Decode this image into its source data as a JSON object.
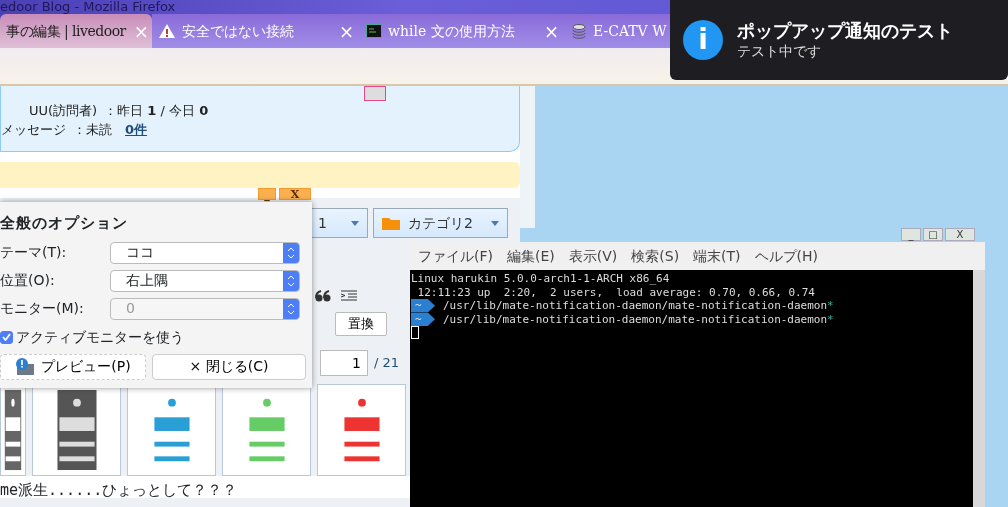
{
  "browser": {
    "title": "edoor Blog - Mozilla Firefox",
    "tabs": [
      {
        "label": "事の編集 | livedoor",
        "selected": true,
        "kind": "plain",
        "close": "×"
      },
      {
        "label": "安全ではない接続",
        "selected": false,
        "kind": "warning",
        "close": "×"
      },
      {
        "label": "while 文の使用方法",
        "selected": false,
        "kind": "terminal",
        "close": "×"
      },
      {
        "label": "E-CATV W",
        "selected": false,
        "kind": "stack"
      }
    ],
    "stats": [
      {
        "link": "UU(訪問者)",
        "text": "：昨日 **1** / 今日 **0**"
      },
      {
        "link": "メッセージ",
        "text": "：未読",
        "count": "0件"
      }
    ],
    "categories": [
      {
        "label": "1",
        "kind": "plain"
      },
      {
        "label": "カテゴリ2",
        "kind": "folder"
      }
    ],
    "replace_button": "置換",
    "page_input": "1",
    "page_total": "/ 21",
    "caption": "me派生......ひょっとして？？？"
  },
  "dialog": {
    "window_buttons": [
      "_",
      "X"
    ],
    "title": "全般のオプション",
    "fields": [
      {
        "label": "テーマ(T):",
        "value": "ココ",
        "disabled": false
      },
      {
        "label": "位置(O):",
        "value": "右上隅",
        "disabled": false
      },
      {
        "label": "モニター(M):",
        "value": "0",
        "disabled": true
      }
    ],
    "checkbox": {
      "label": "アクティブモニターを使う",
      "checked": true
    },
    "preview_button": "プレビュー(P)",
    "close_button": {
      "mark": "×",
      "label": "閉じる(C)"
    }
  },
  "terminal": {
    "window_buttons": [
      "_",
      "□",
      "X"
    ],
    "menu": [
      "ファイル(F)",
      "編集(E)",
      "表示(V)",
      "検索(S)",
      "端末(T)",
      "ヘルプ(H)"
    ],
    "lines": [
      {
        "kind": "text",
        "text": "Linux harukin 5.0.0-arch1-1-ARCH x86_64"
      },
      {
        "kind": "text",
        "text": " 12:11:23 up  2:20,  2 users,  load average: 0.70, 0.66, 0.74"
      },
      {
        "kind": "prompt",
        "dir": "~",
        "text": "/usr/lib/mate-notification-daemon/mate-notification-daemon",
        "suffix": "*"
      },
      {
        "kind": "prompt",
        "dir": "~",
        "text": "/usr/lib/mate-notification-daemon/mate-notification-daemon",
        "suffix": "*"
      },
      {
        "kind": "cursor"
      }
    ]
  },
  "notification": {
    "icon": "i",
    "title": "ポップアップ通知のテスト",
    "body": "テスト中です"
  }
}
